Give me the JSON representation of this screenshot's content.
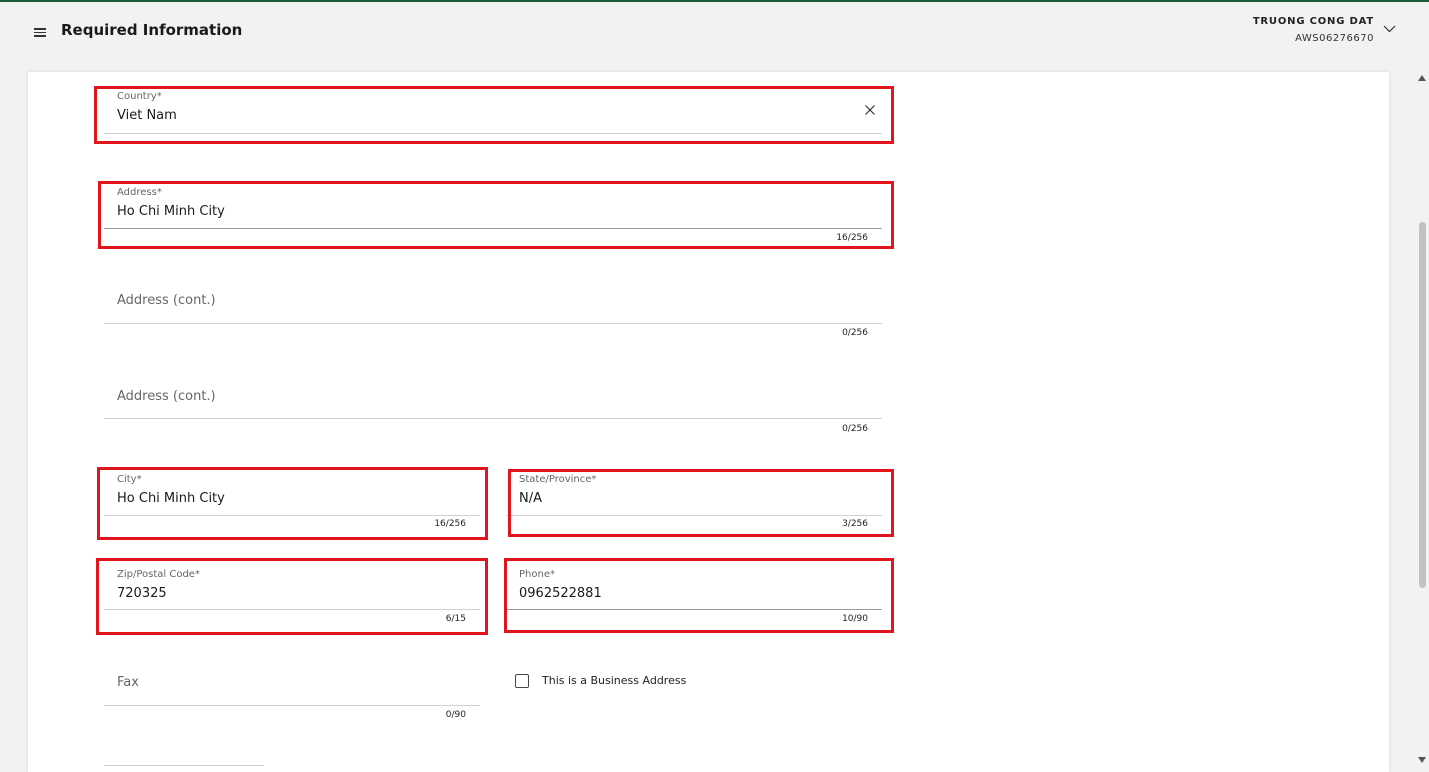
{
  "header": {
    "title": "Required Information",
    "user_name": "TRUONG CONG DAT",
    "user_id": "AWS06276670"
  },
  "form": {
    "country": {
      "label": "Country*",
      "value": "Viet Nam"
    },
    "address": {
      "label": "Address*",
      "value": "Ho Chi Minh City",
      "counter": "16/256"
    },
    "address2": {
      "placeholder": "Address (cont.)",
      "counter": "0/256"
    },
    "address3": {
      "placeholder": "Address (cont.)",
      "counter": "0/256"
    },
    "city": {
      "label": "City*",
      "value": "Ho Chi Minh City",
      "counter": "16/256"
    },
    "state": {
      "label": "State/Province*",
      "value": "N/A",
      "counter": "3/256"
    },
    "zip": {
      "label": "Zip/Postal Code*",
      "value": "720325",
      "counter": "6/15"
    },
    "phone": {
      "label": "Phone*",
      "value": "0962522881",
      "counter": "10/90"
    },
    "fax": {
      "placeholder": "Fax",
      "counter": "0/90"
    },
    "business_address": {
      "label": "This is a Business Address",
      "checked": false
    }
  },
  "colors": {
    "highlight": "#e0161c",
    "accent": "#1e5b3a"
  }
}
